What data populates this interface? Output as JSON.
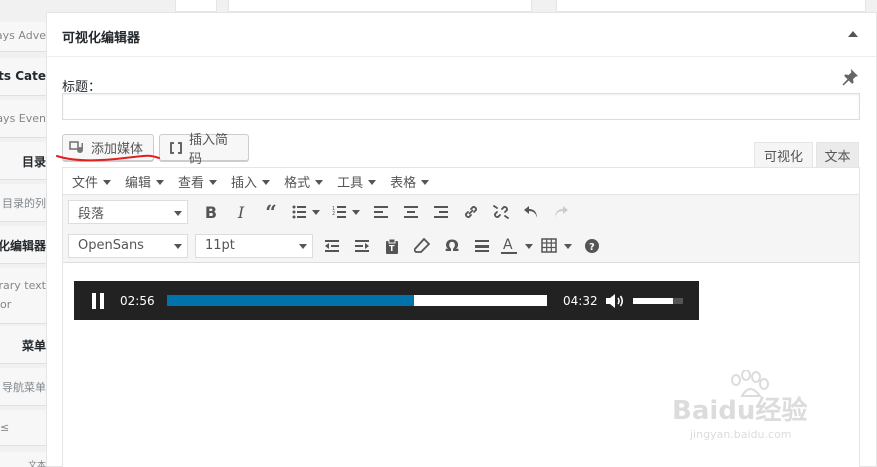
{
  "sidebar": {
    "items": [
      {
        "label": "ays Adve",
        "style": "light"
      },
      {
        "label": "nts Cate",
        "style": "bold"
      },
      {
        "label": "ays Even",
        "style": "light"
      },
      {
        "label": "目录",
        "style": "bold"
      },
      {
        "label": "目录的列",
        "style": "light"
      },
      {
        "label": "化编辑器",
        "style": "bold"
      },
      {
        "label": "rary text",
        "style": "light"
      },
      {
        "label": "or",
        "style": "light"
      },
      {
        "label": "菜单",
        "style": "bold"
      },
      {
        "label": "导航菜单",
        "style": "light"
      },
      {
        "label": "≤",
        "style": "light"
      },
      {
        "label": "文本",
        "style": "light"
      }
    ]
  },
  "widget": {
    "title": "可视化编辑器",
    "title_label": "标题：",
    "title_value": ""
  },
  "buttons": {
    "add_media": "添加媒体",
    "insert_shortcode": "插入简码"
  },
  "tabs": {
    "visual": "可视化",
    "text": "文本"
  },
  "menubar": [
    "文件",
    "编辑",
    "查看",
    "插入",
    "格式",
    "工具",
    "表格"
  ],
  "toolbar": {
    "format_select": "段落",
    "font_select": "OpenSans",
    "size_select": "11pt",
    "icons": [
      "bold-icon",
      "italic-icon",
      "blockquote-icon",
      "bullet-list-icon",
      "numbered-list-icon",
      "align-left-icon",
      "align-center-icon",
      "align-right-icon",
      "link-icon",
      "unlink-icon",
      "undo-icon",
      "redo-icon",
      "outdent-icon",
      "indent-icon",
      "paste-text-icon",
      "clear-format-icon",
      "special-char-icon",
      "hr-icon",
      "text-color-icon",
      "table-icon",
      "help-icon"
    ]
  },
  "player": {
    "current_time": "02:56",
    "duration": "04:32",
    "progress_fraction": 0.65,
    "volume_fraction": 0.8,
    "accent_color": "#0073aa"
  },
  "watermark": {
    "brand": "Baidu经验",
    "url": "jingyan.baidu.com"
  },
  "colors": {
    "annotation_red": "#e02020"
  }
}
